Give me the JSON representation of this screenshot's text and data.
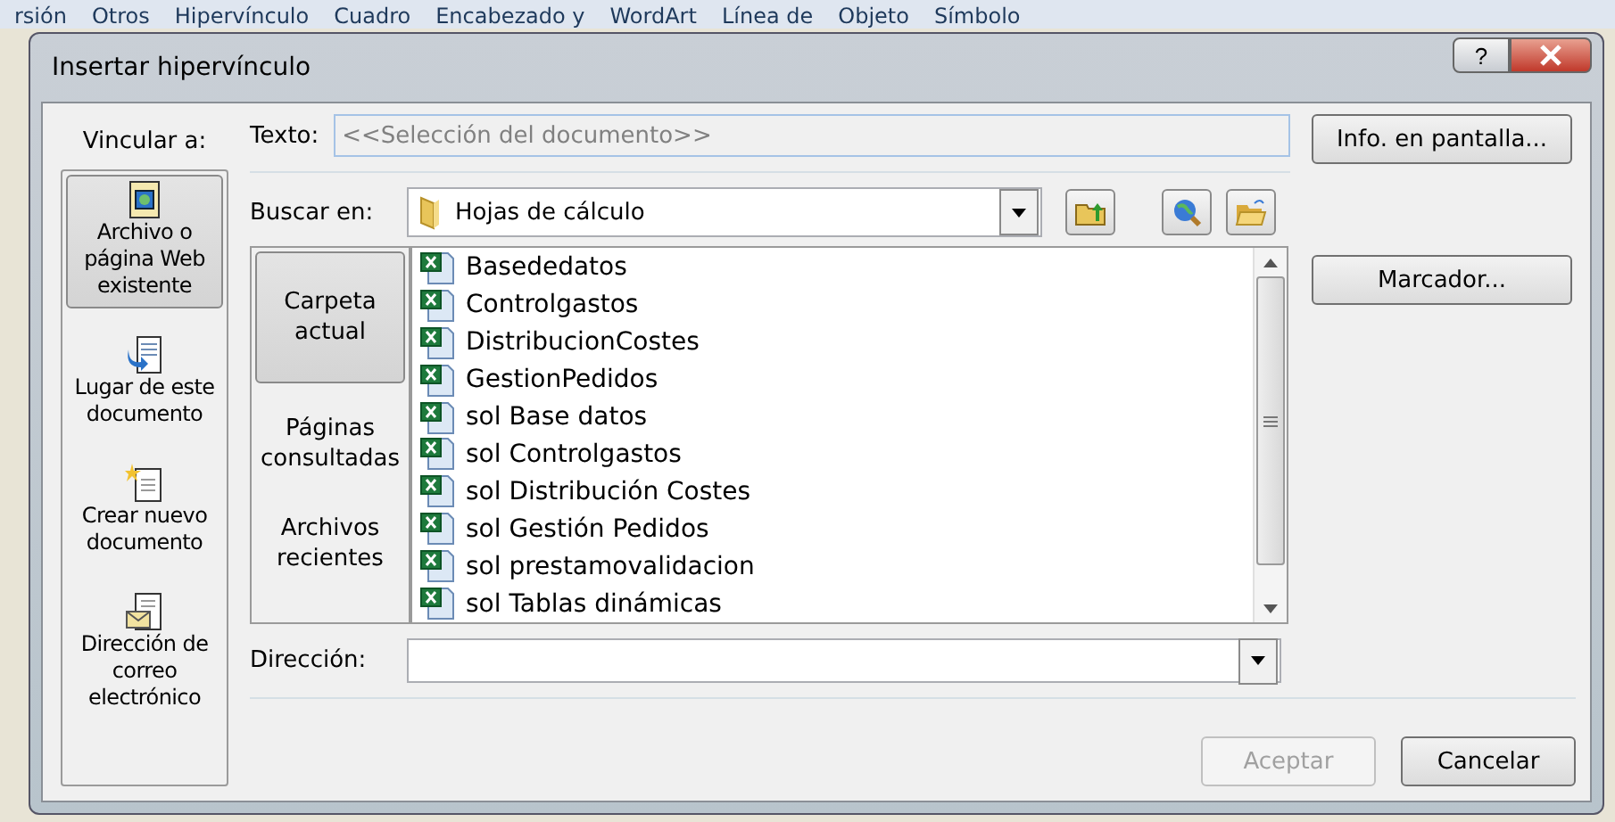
{
  "background_ribbon": [
    "rsión",
    "Otros",
    "Hipervínculo",
    "Cuadro",
    "Encabezado y",
    "WordArt",
    "Línea de",
    "Objeto",
    "Símbolo"
  ],
  "window": {
    "title": "Insertar hipervínculo",
    "help": "?"
  },
  "link_to": {
    "label": "Vincular a:",
    "items": [
      {
        "label": "Archivo o página Web existente",
        "kind": "file",
        "selected": true
      },
      {
        "label": "Lugar de este documento",
        "kind": "place",
        "selected": false
      },
      {
        "label": "Crear nuevo documento",
        "kind": "new",
        "selected": false
      },
      {
        "label": "Dirección de correo electrónico",
        "kind": "mail",
        "selected": false
      }
    ]
  },
  "text_field": {
    "label": "Texto:",
    "value": "<<Selección del documento>>"
  },
  "screen_tip_button": "Info. en pantalla...",
  "look_in": {
    "label": "Buscar en:",
    "value": "Hojas de cálculo"
  },
  "sources": [
    {
      "label": "Carpeta actual",
      "selected": true
    },
    {
      "label": "Páginas consultadas",
      "selected": false
    },
    {
      "label": "Archivos recientes",
      "selected": false
    }
  ],
  "files": [
    "Basededatos",
    "Controlgastos",
    "DistribucionCostes",
    "GestionPedidos",
    "sol Base datos",
    "sol Controlgastos",
    "sol Distribución Costes",
    "sol Gestión Pedidos",
    "sol prestamovalidacion",
    "sol Tablas dinámicas"
  ],
  "bookmark_button": "Marcador...",
  "address": {
    "label": "Dirección:"
  },
  "buttons": [
    {
      "label": "Aceptar",
      "disabled": true
    },
    {
      "label": "Cancelar",
      "disabled": false
    }
  ]
}
